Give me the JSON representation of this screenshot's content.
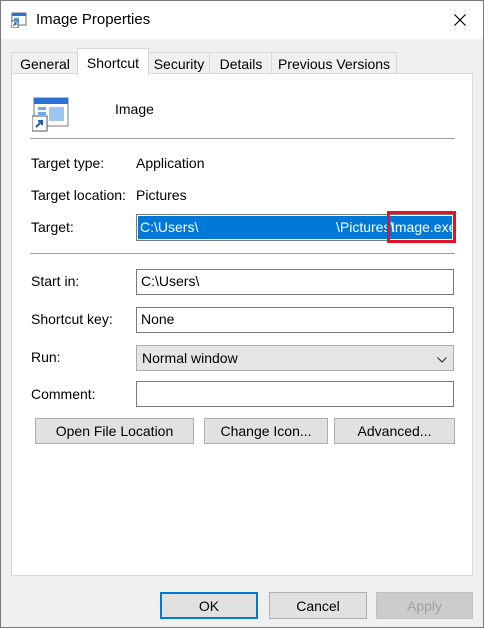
{
  "window": {
    "title": "Image Properties"
  },
  "tabs": [
    "General",
    "Shortcut",
    "Security",
    "Details",
    "Previous Versions"
  ],
  "shortcut": {
    "name": "Image",
    "target_type_label": "Target type:",
    "target_type": "Application",
    "target_location_label": "Target location:",
    "target_location": "Pictures",
    "target_label": "Target:",
    "target_part1": "C:\\Users\\",
    "target_part2": "\\Pictures\\",
    "target_part3": "Image.exe",
    "start_in_label": "Start in:",
    "start_in": "C:\\Users\\",
    "shortcut_key_label": "Shortcut key:",
    "shortcut_key": "None",
    "run_label": "Run:",
    "run": "Normal window",
    "comment_label": "Comment:",
    "comment": ""
  },
  "actions": {
    "open_file_location": "Open File Location",
    "change_icon": "Change Icon...",
    "advanced": "Advanced..."
  },
  "footer": {
    "ok": "OK",
    "cancel": "Cancel",
    "apply": "Apply"
  },
  "colors": {
    "selection": "#0078d7",
    "highlight_box": "#e81123",
    "accent": "#0078d7"
  }
}
